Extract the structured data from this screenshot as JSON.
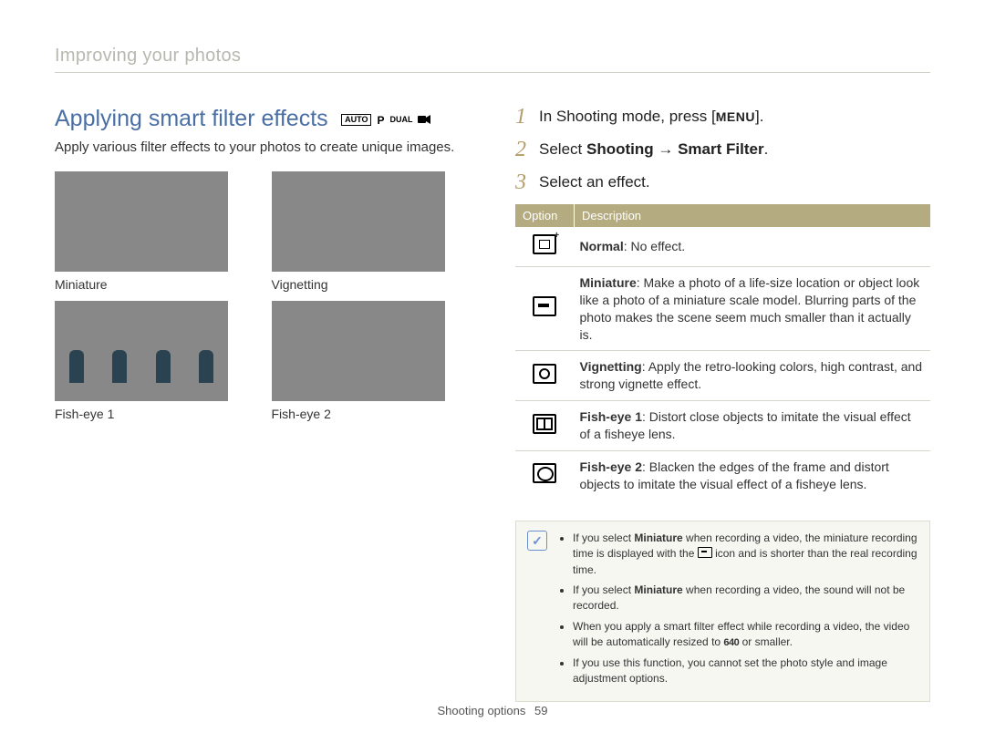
{
  "breadcrumb": "Improving your photos",
  "heading": "Applying smart filter effects",
  "mode_labels": {
    "auto": "AUTO",
    "p": "P",
    "dual": "DUAL"
  },
  "intro": "Apply various filter effects to your photos to create unique images.",
  "samples": {
    "miniature": "Miniature",
    "vignetting": "Vignetting",
    "fisheye1": "Fish-eye 1",
    "fisheye2": "Fish-eye 2"
  },
  "steps": {
    "s1_num": "1",
    "s1_a": "In Shooting mode, press [",
    "s1_menu": "MENU",
    "s1_b": "].",
    "s2_num": "2",
    "s2_a": "Select ",
    "s2_b": "Shooting",
    "s2_c": " → ",
    "s2_d": "Smart Filter",
    "s2_e": ".",
    "s3_num": "3",
    "s3_a": "Select an effect."
  },
  "table": {
    "header_option": "Option",
    "header_desc": "Description",
    "rows": {
      "normal_title": "Normal",
      "normal_desc": ": No effect.",
      "mini_title": "Miniature",
      "mini_desc": ": Make a photo of a life-size location or object look like a photo of a miniature scale model. Blurring parts of the photo makes the scene seem much smaller than it actually is.",
      "vig_title": "Vignetting",
      "vig_desc": ": Apply the retro-looking colors, high contrast, and strong vignette effect.",
      "fe1_title": "Fish-eye 1",
      "fe1_desc": ": Distort close objects to imitate the visual effect of a fisheye lens.",
      "fe2_title": "Fish-eye 2",
      "fe2_desc": ": Blacken the edges of the frame and distort objects to imitate the visual effect of a fisheye lens."
    }
  },
  "note": {
    "b1_a": "If you select ",
    "b1_bold": "Miniature",
    "b1_b": " when recording a video, the miniature recording time is displayed with the ",
    "b1_c": " icon and is shorter than the real recording time.",
    "b2_a": "If you select ",
    "b2_bold": "Miniature",
    "b2_b": " when recording a video, the sound will not be recorded.",
    "b3_a": "When you apply a smart filter effect while recording a video, the video will be automatically resized to ",
    "b3_res": "640",
    "b3_b": " or smaller.",
    "b4": "If you use this function, you cannot set the photo style and image adjustment options."
  },
  "footer": {
    "section": "Shooting options",
    "page": "59"
  }
}
